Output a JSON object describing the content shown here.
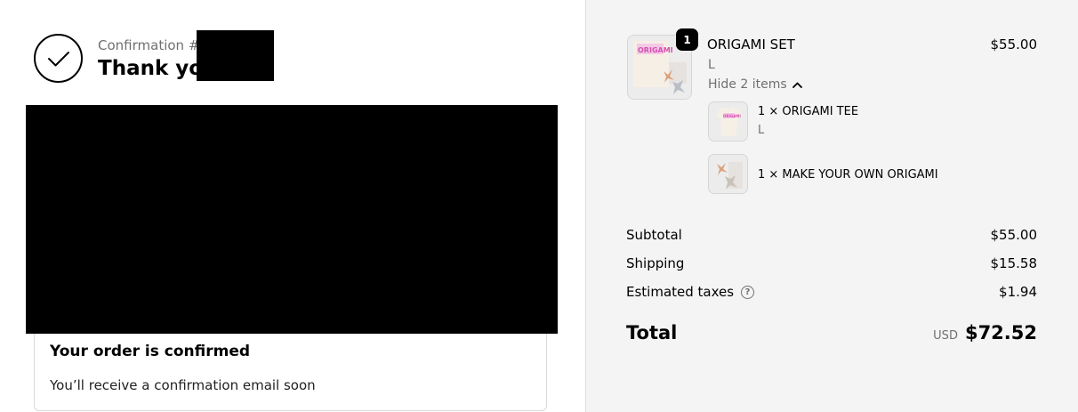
{
  "confirmation": {
    "number_label": "Confirmation #K",
    "thank_you": "Thank you"
  },
  "order_status": {
    "title": "Your order is confirmed",
    "message": "You’ll receive a confirmation email soon"
  },
  "summary": {
    "item": {
      "quantity": "1",
      "name": "ORIGAMI SET",
      "variant": "L",
      "toggle_label": "Hide 2 items",
      "price": "$55.00",
      "thumbnail_text": "ORIGAMI",
      "components": [
        {
          "label": "1 × ORIGAMI TEE",
          "variant": "L",
          "thumbnail_text": "ORIGAMI"
        },
        {
          "label": "1 × MAKE YOUR OWN ORIGAMI"
        }
      ]
    },
    "subtotal_label": "Subtotal",
    "subtotal_value": "$55.00",
    "shipping_label": "Shipping",
    "shipping_value": "$15.58",
    "taxes_label": "Estimated taxes",
    "taxes_value": "$1.94",
    "total_label": "Total",
    "currency": "USD",
    "total_value": "$72.52"
  },
  "colors": {
    "summary_background": "#f4f4f4",
    "muted_text": "#707070",
    "redaction": "#000000"
  },
  "icons": [
    "checkmark-icon",
    "chevron-up-icon",
    "help-circle-icon"
  ]
}
